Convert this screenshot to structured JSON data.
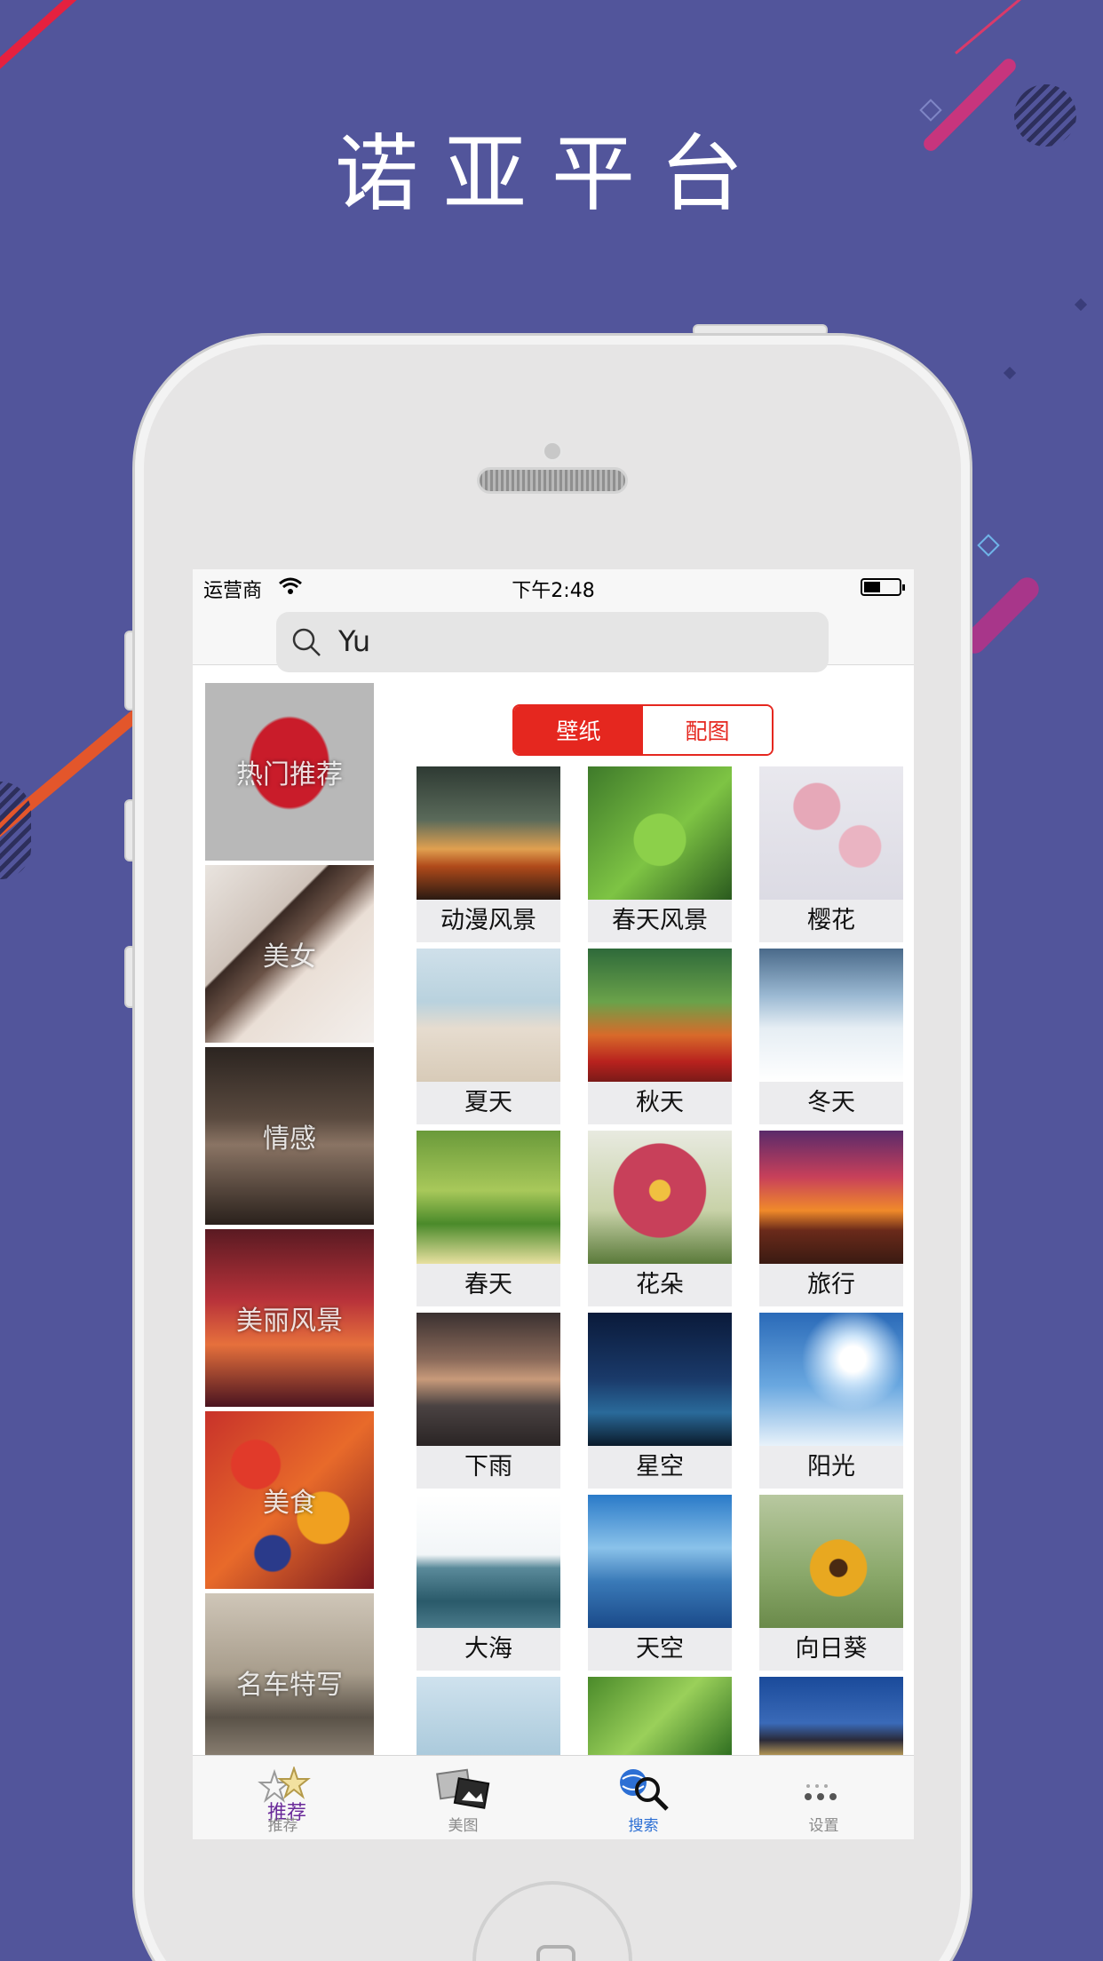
{
  "headline": "诺亚平台",
  "status_bar": {
    "carrier": "运营商",
    "time": "下午2:48"
  },
  "search": {
    "value": "Yu"
  },
  "categories": [
    {
      "label": "热门推荐"
    },
    {
      "label": "美女"
    },
    {
      "label": "情感"
    },
    {
      "label": "美丽风景"
    },
    {
      "label": "美食"
    },
    {
      "label": "名车特写"
    }
  ],
  "segment": {
    "wallpaper": "壁纸",
    "images": "配图",
    "selected": "壁纸"
  },
  "grid_items": [
    {
      "label": "动漫风景"
    },
    {
      "label": "春天风景"
    },
    {
      "label": "樱花"
    },
    {
      "label": "夏天"
    },
    {
      "label": "秋天"
    },
    {
      "label": "冬天"
    },
    {
      "label": "春天"
    },
    {
      "label": "花朵"
    },
    {
      "label": "旅行"
    },
    {
      "label": "下雨"
    },
    {
      "label": "星空"
    },
    {
      "label": "阳光"
    },
    {
      "label": "大海"
    },
    {
      "label": "天空"
    },
    {
      "label": "向日葵"
    }
  ],
  "tabbar": {
    "items": [
      {
        "label": "推荐",
        "overlay": "推荐",
        "icon": "stars-icon"
      },
      {
        "label": "美图",
        "icon": "photos-icon"
      },
      {
        "label": "搜索",
        "icon": "globe-search-icon"
      },
      {
        "label": "设置",
        "icon": "more-dots-icon"
      }
    ],
    "active": "搜索"
  },
  "colors": {
    "background": "#52559b",
    "accent_red": "#e5271f",
    "tab_active": "#2c6fd4"
  }
}
